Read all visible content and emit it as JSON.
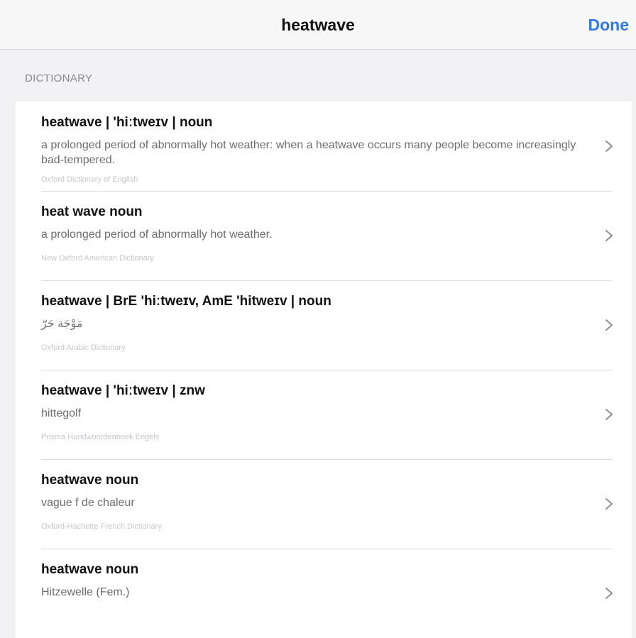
{
  "navbar": {
    "title": "heatwave",
    "done_label": "Done"
  },
  "section": {
    "header": "DICTIONARY"
  },
  "entries": [
    {
      "title": "heatwave | 'hiːtweɪv | noun",
      "definition": "a prolonged period of abnormally hot weather: when a heatwave occurs many people become increasingly bad-tempered.",
      "source": "Oxford Dictionary of English"
    },
    {
      "title": "heat wave noun",
      "definition": "a prolonged period of abnormally hot weather.",
      "source": "New Oxford American Dictionary"
    },
    {
      "title": "heatwave | BrE 'hiːtweɪv, AmE 'hitweɪv | noun",
      "definition": "مَوْجَة حَرّ",
      "source": "Oxford Arabic Dictionary"
    },
    {
      "title": "heatwave | 'hiːtweɪv | znw",
      "definition": "hittegolf",
      "source": "Prisma Handwoordenboek Engels"
    },
    {
      "title": "heatwave noun",
      "definition": "vague f de chaleur",
      "source": "Oxford-Hachette French Dictionary"
    },
    {
      "title": "heatwave noun",
      "definition": "Hitzewelle (Fem.)",
      "source": ""
    }
  ],
  "colors": {
    "accent": "#2f7ae8",
    "background": "#f2f2f4",
    "row_background": "#ffffff"
  },
  "icons": {
    "row_disclosure": "chevron-right-icon"
  }
}
